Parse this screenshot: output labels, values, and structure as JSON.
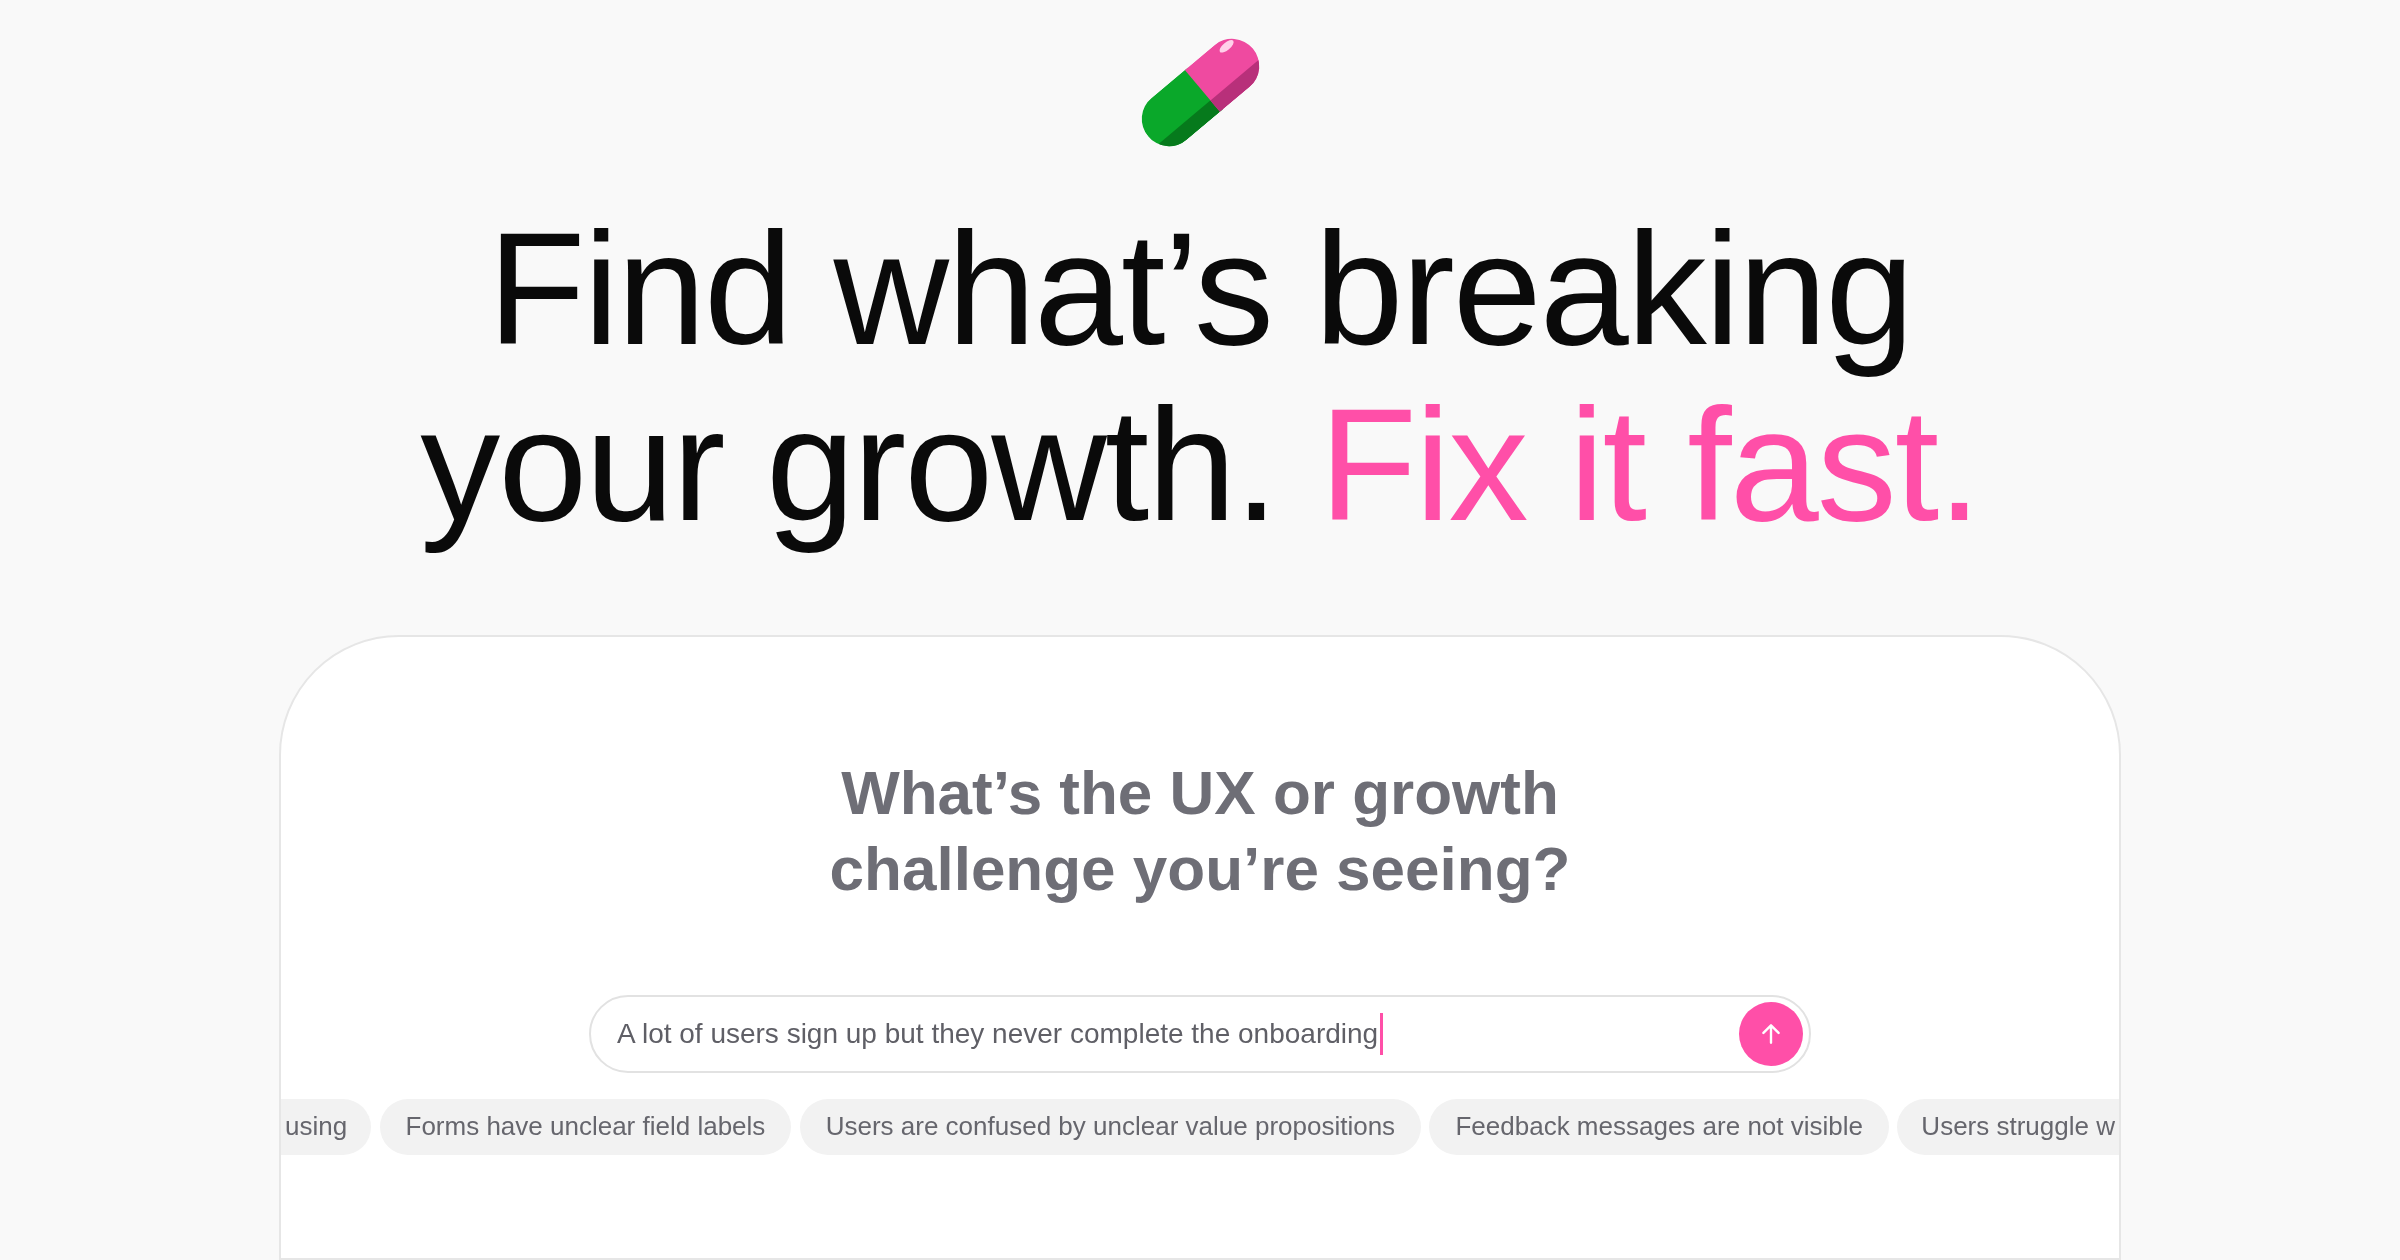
{
  "headline": {
    "line_1": "Find what’s breaking",
    "line_2": "your growth.",
    "highlight": "Fix it fast."
  },
  "card": {
    "question": "What’s the UX or growth challenge you’re seeing?",
    "input": {
      "value": "A lot of users sign up but they never complete the onboarding"
    },
    "suggestions": [
      "using",
      "Forms have unclear field labels",
      "Users are confused by unclear value propositions",
      "Feedback messages are not visible",
      "Users struggle w"
    ]
  }
}
